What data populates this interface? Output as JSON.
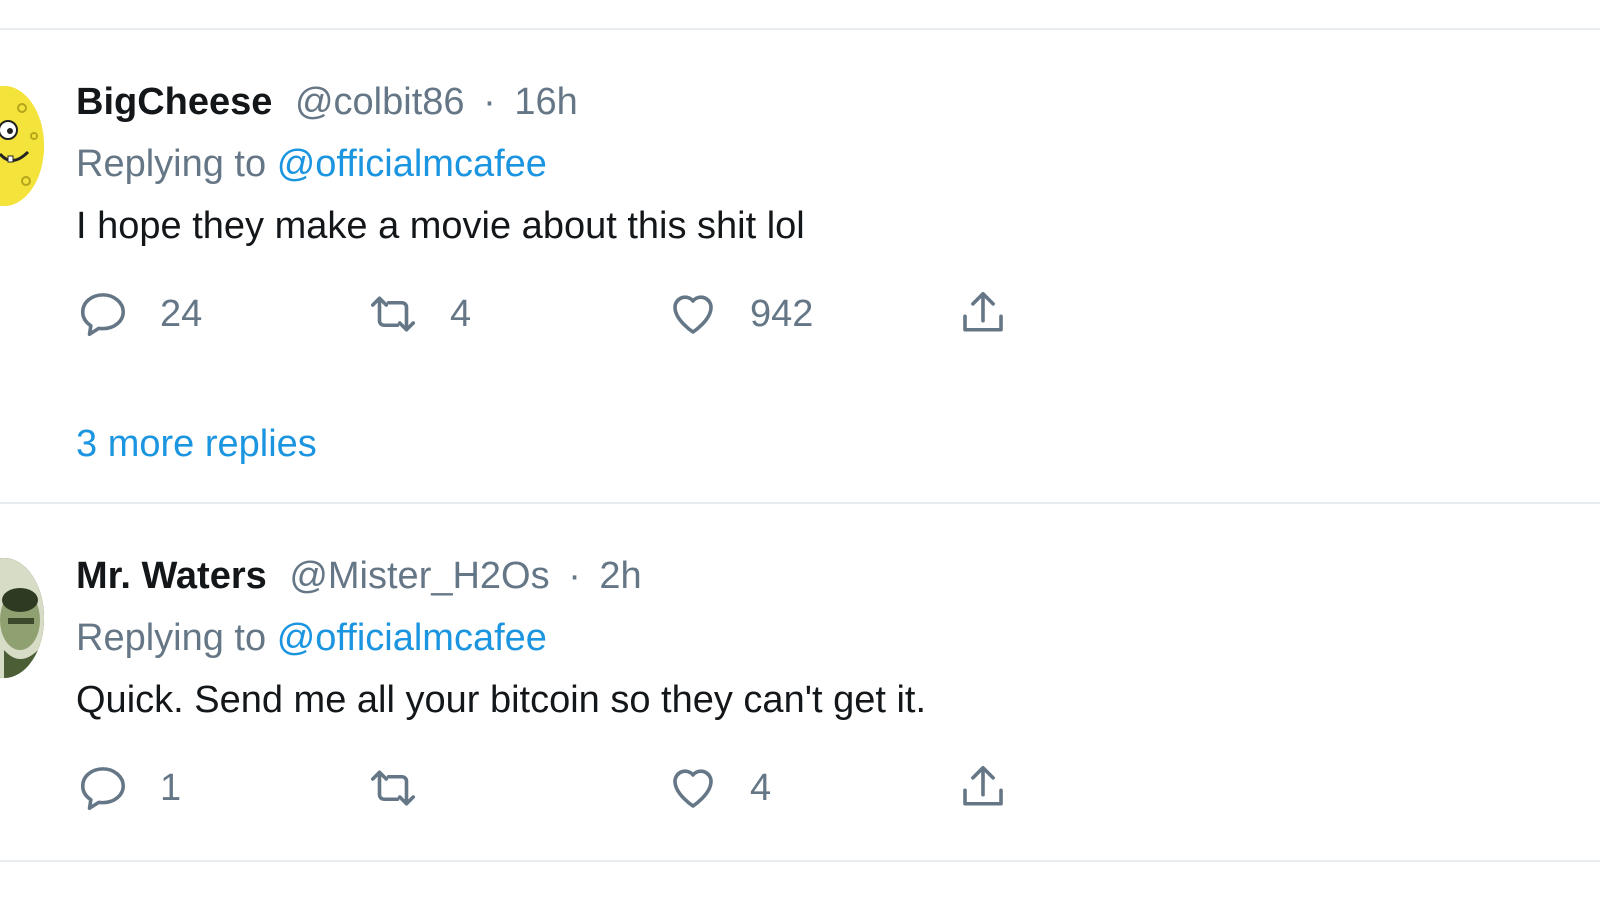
{
  "tweets": [
    {
      "name": "BigCheese",
      "handle": "@colbit86",
      "separator": "·",
      "time": "16h",
      "replying_prefix": "Replying to",
      "replying_to": "@officialmcafee",
      "text": "I hope they make a movie about this shit lol",
      "replies": "24",
      "retweets": "4",
      "likes": "942",
      "more_replies": "3 more replies",
      "avatar_icon": "spongebob-avatar"
    },
    {
      "name": "Mr. Waters",
      "handle": "@Mister_H2Os",
      "separator": "·",
      "time": "2h",
      "replying_prefix": "Replying to",
      "replying_to": "@officialmcafee",
      "text": "Quick. Send me all your bitcoin so they can't get it.",
      "replies": "1",
      "retweets": "",
      "likes": "4",
      "avatar_icon": "green-portrait-avatar"
    }
  ],
  "icons": {
    "reply": "reply-icon",
    "retweet": "retweet-icon",
    "like": "heart-icon",
    "share": "share-icon"
  },
  "colors": {
    "link": "#1b95e0",
    "secondary": "#657786",
    "divider": "#e6ecf0"
  }
}
